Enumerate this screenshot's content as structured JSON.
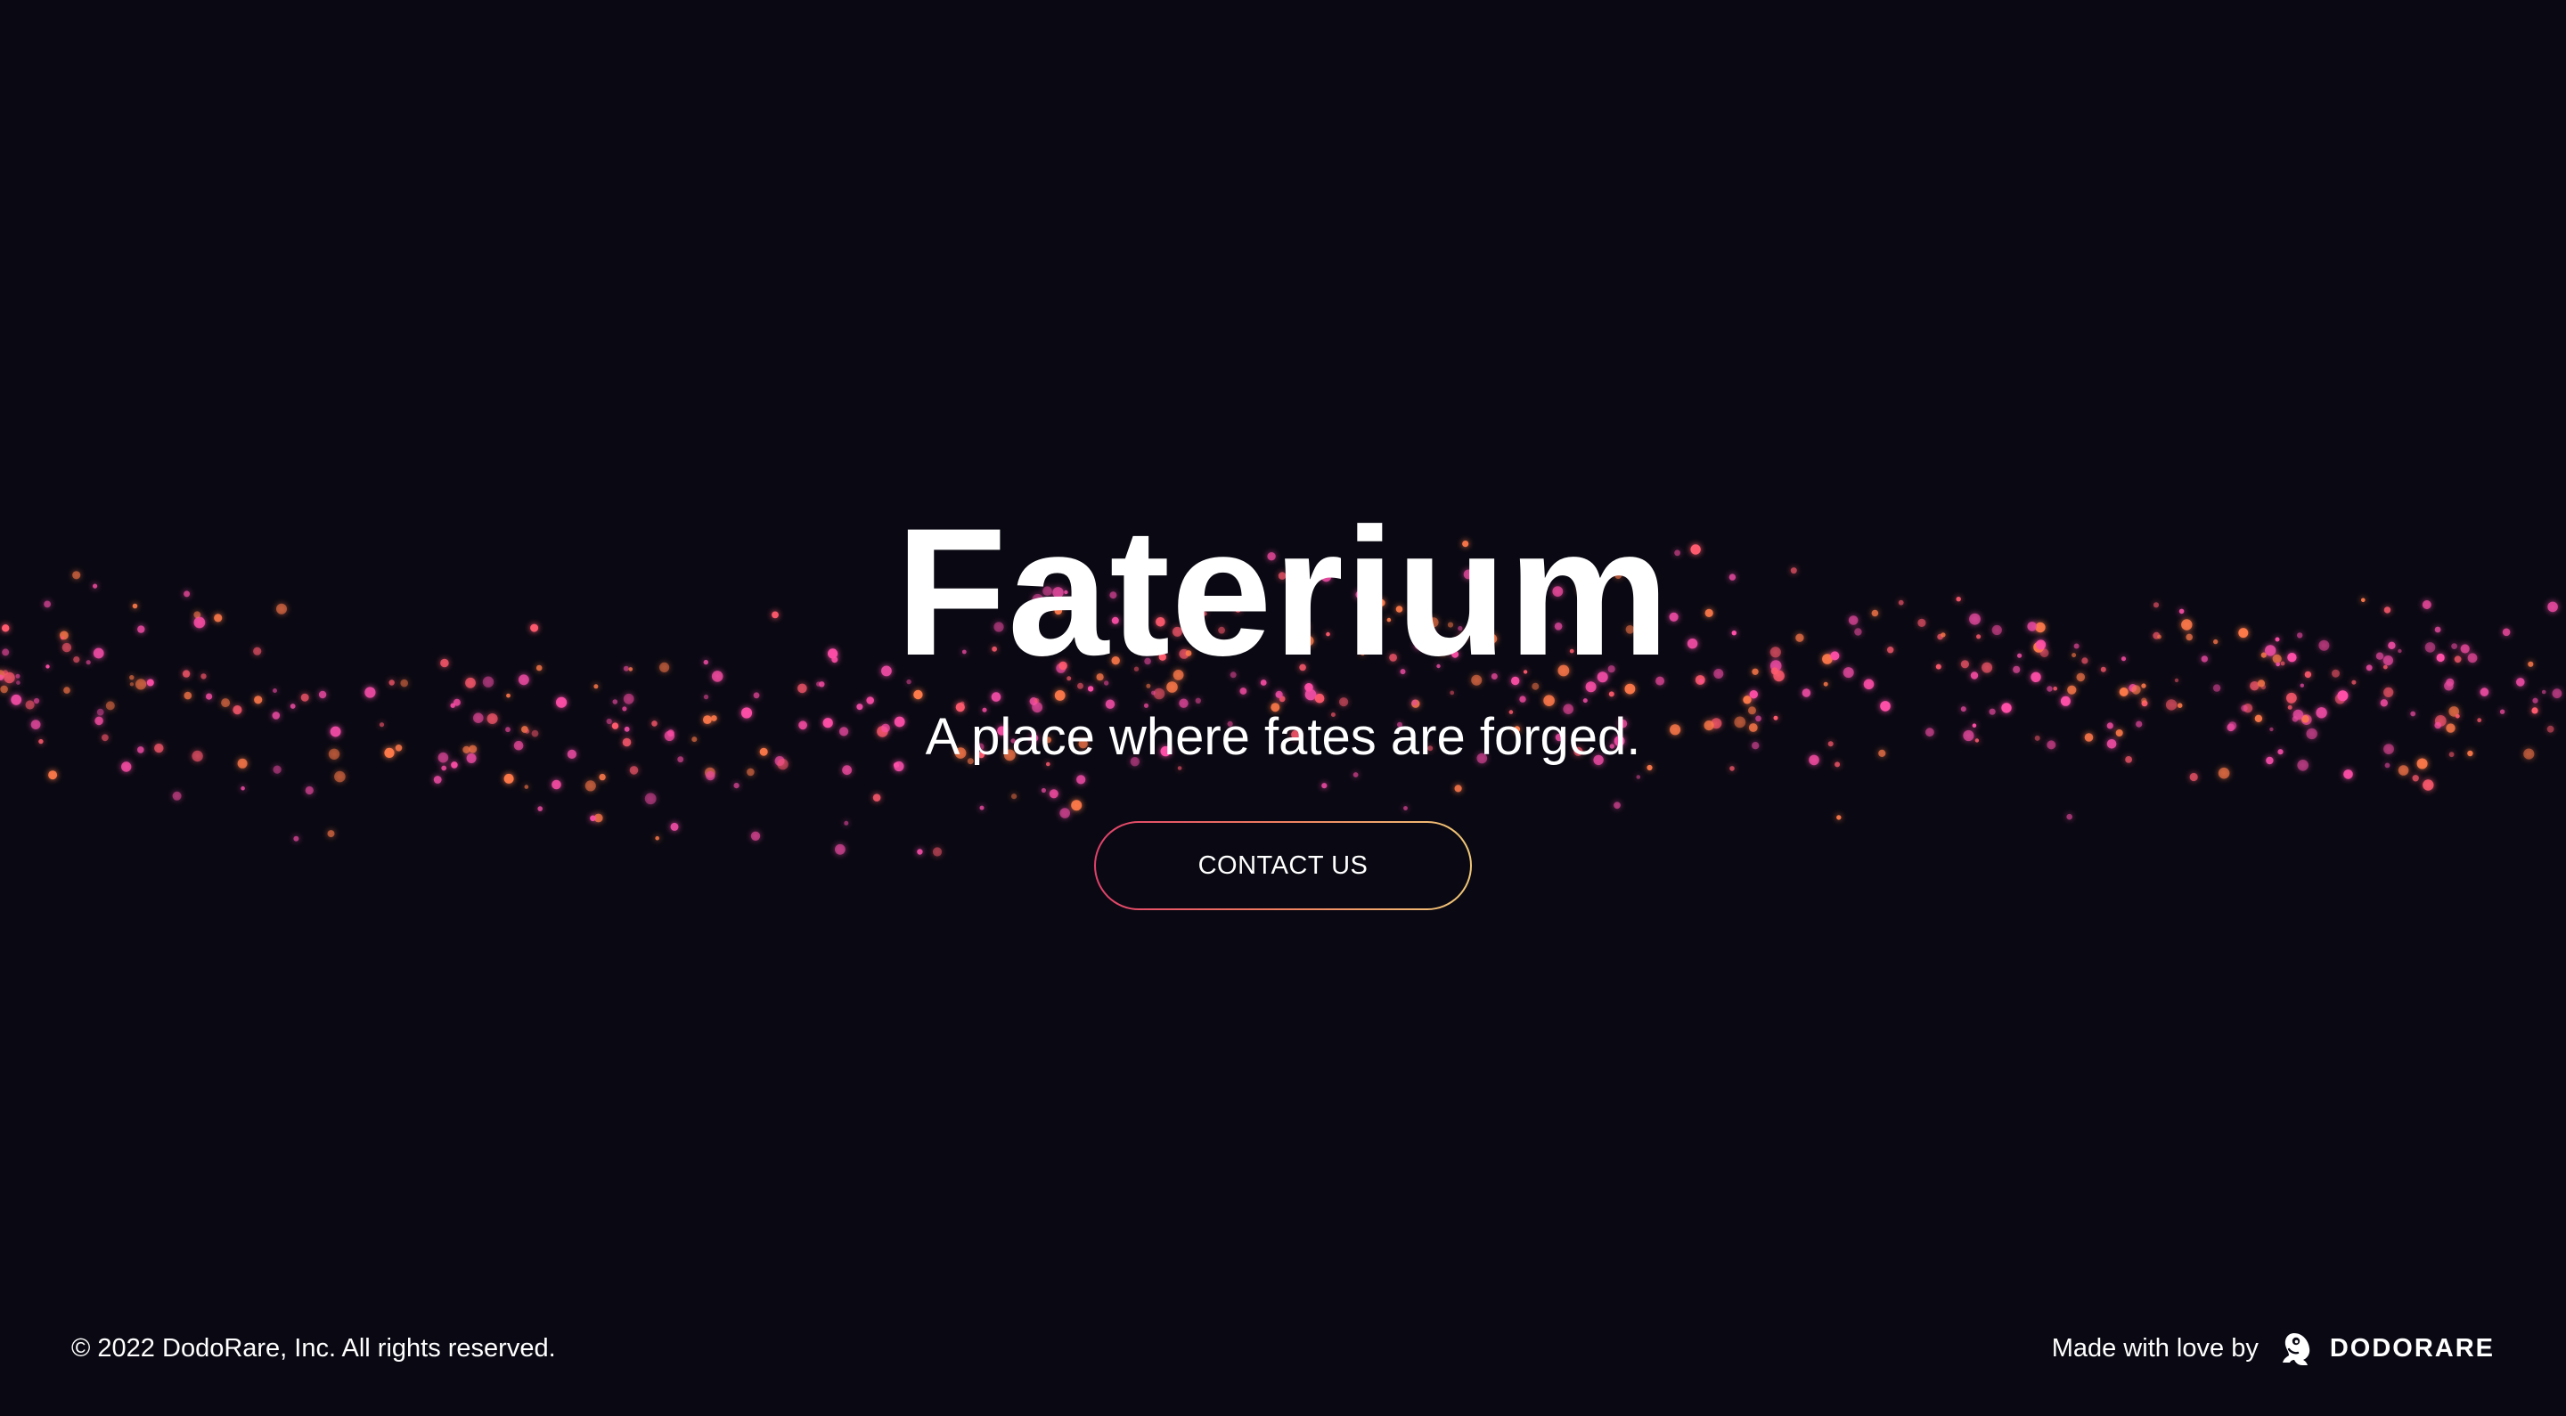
{
  "hero": {
    "title": "Faterium",
    "tagline": "A place where fates are forged.",
    "cta_label": "CONTACT US"
  },
  "footer": {
    "copyright": "© 2022 DodoRare, Inc. All rights reserved.",
    "made_with": "Made with love by",
    "brand_name": "DODORARE",
    "brand_icon": "dodo-bird-logo-icon"
  },
  "theme": {
    "background": "#0a0913",
    "particle_colors": [
      "#ff4fa8",
      "#ff5a6e",
      "#ff7a4a",
      "#e84aa0"
    ],
    "cta_border_gradient": [
      "#e0406a",
      "#f08060",
      "#f0c878"
    ]
  }
}
